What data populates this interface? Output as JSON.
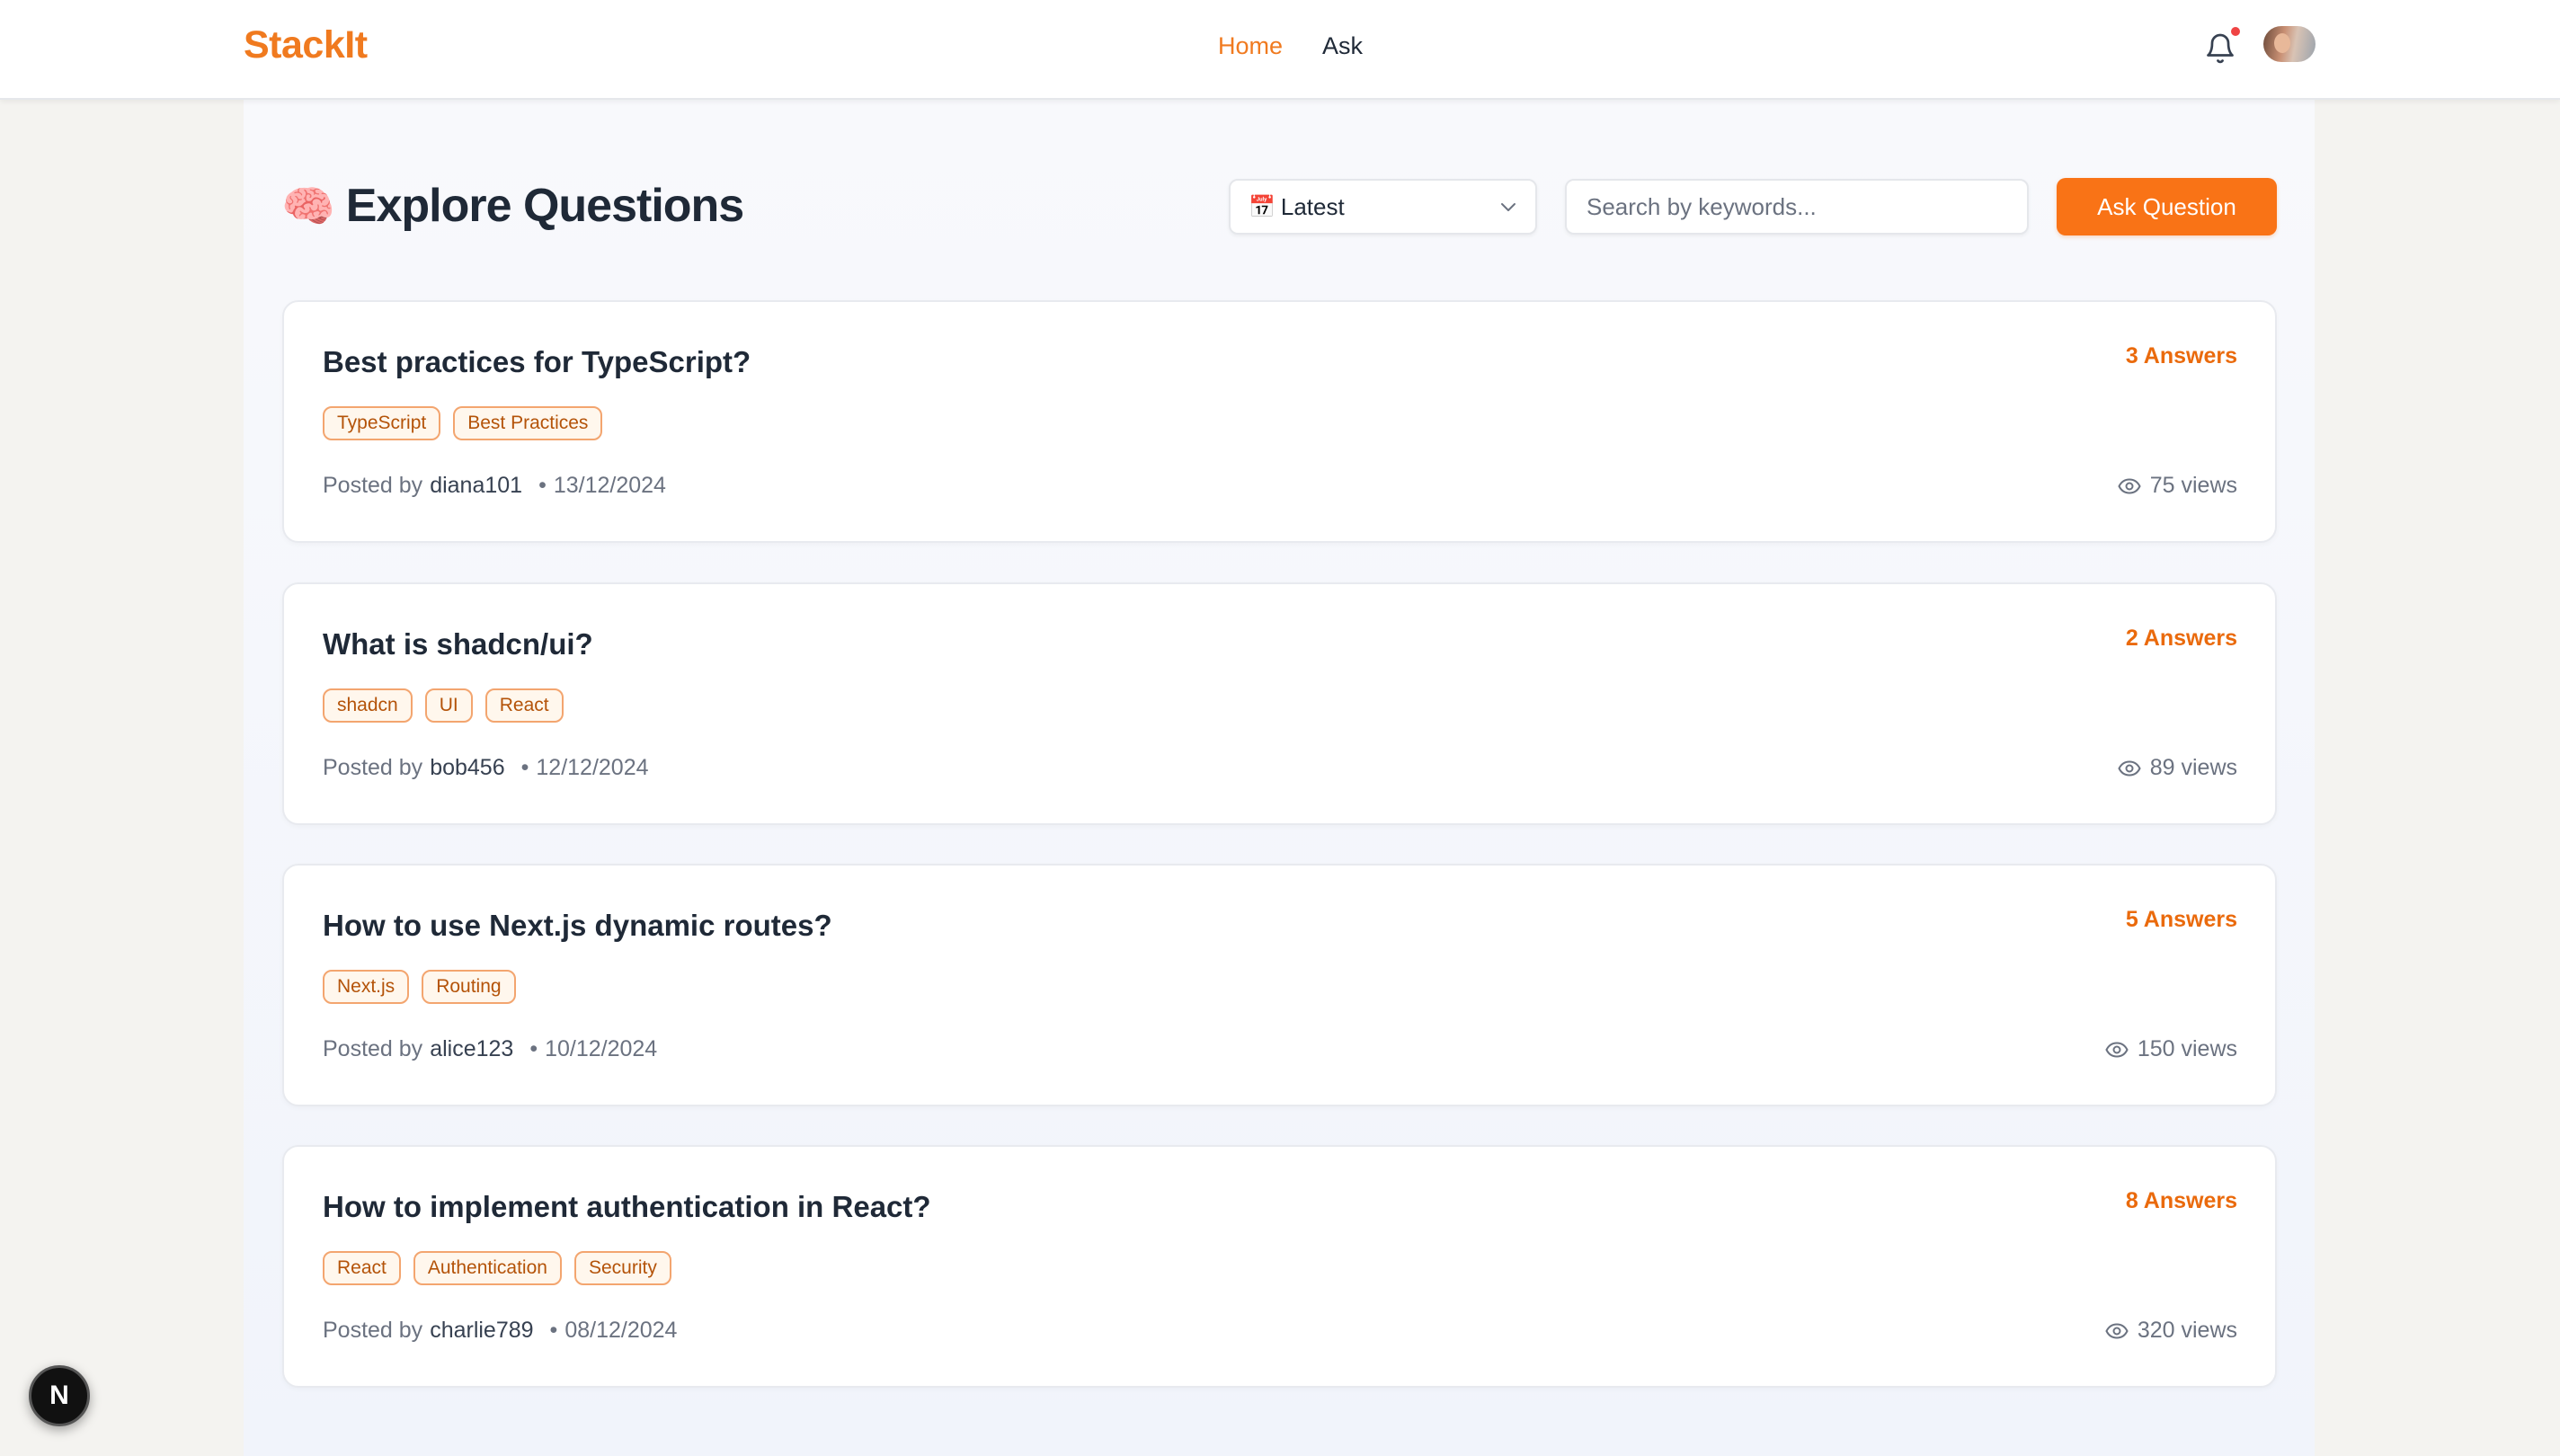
{
  "brand": "StackIt",
  "nav": {
    "home": "Home",
    "ask": "Ask"
  },
  "header": {
    "notification_icon": "bell-icon",
    "avatar_icon": "user-avatar"
  },
  "page": {
    "title_emoji": "🧠",
    "title": "Explore Questions",
    "sort": {
      "icon": "📅",
      "selected": "Latest"
    },
    "search_placeholder": "Search by keywords...",
    "ask_button": "Ask Question"
  },
  "questions": [
    {
      "title": "Best practices for TypeScript?",
      "answers": "3 Answers",
      "tags": [
        "TypeScript",
        "Best Practices"
      ],
      "posted_by_label": "Posted by",
      "author": "diana101",
      "date": "13/12/2024",
      "views": "75 views"
    },
    {
      "title": "What is shadcn/ui?",
      "answers": "2 Answers",
      "tags": [
        "shadcn",
        "UI",
        "React"
      ],
      "posted_by_label": "Posted by",
      "author": "bob456",
      "date": "12/12/2024",
      "views": "89 views"
    },
    {
      "title": "How to use Next.js dynamic routes?",
      "answers": "5 Answers",
      "tags": [
        "Next.js",
        "Routing"
      ],
      "posted_by_label": "Posted by",
      "author": "alice123",
      "date": "10/12/2024",
      "views": "150 views"
    },
    {
      "title": "How to implement authentication in React?",
      "answers": "8 Answers",
      "tags": [
        "React",
        "Authentication",
        "Security"
      ],
      "posted_by_label": "Posted by",
      "author": "charlie789",
      "date": "08/12/2024",
      "views": "320 views"
    }
  ],
  "dev_badge": "N",
  "colors": {
    "accent": "#f97316",
    "brand": "#f07a1f",
    "notification": "#ef4444"
  }
}
